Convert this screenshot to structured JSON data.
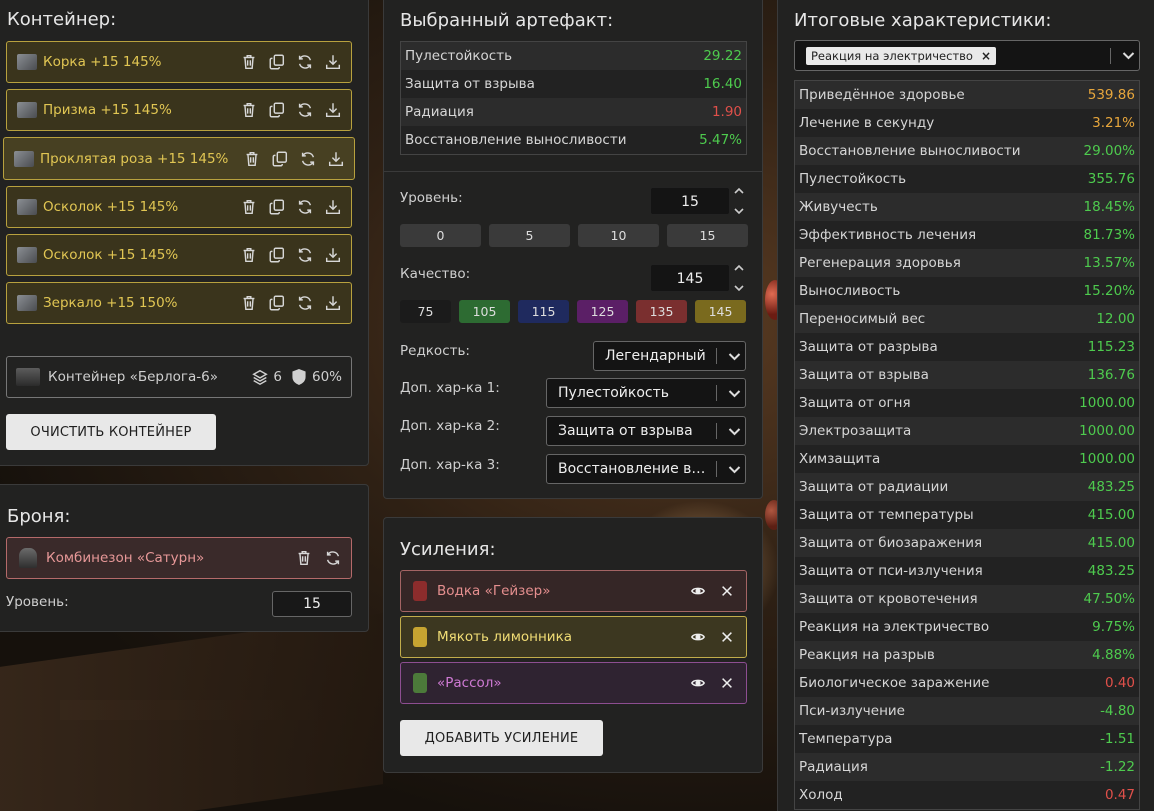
{
  "container": {
    "title": "Контейнер:",
    "artifacts": [
      {
        "name": "Корка +15 145%"
      },
      {
        "name": "Призма +15 145%"
      },
      {
        "name": "Проклятая роза +15 145%"
      },
      {
        "name": "Осколок +15 145%"
      },
      {
        "name": "Осколок +15 145%"
      },
      {
        "name": "Зеркало +15 150%"
      }
    ],
    "box": {
      "name": "Контейнер «Берлога-6»",
      "slots": "6",
      "protection": "60%"
    },
    "clear_label": "ОЧИСТИТЬ КОНТЕЙНЕР"
  },
  "armor": {
    "title": "Броня:",
    "suit": "Комбинезон «Сатурн»",
    "level_label": "Уровень:",
    "level_value": "15"
  },
  "artifact": {
    "title": "Выбранный артефакт:",
    "stats": [
      {
        "name": "Пулестойкость",
        "value": "29.22",
        "tone": "green"
      },
      {
        "name": "Защита от взрыва",
        "value": "16.40",
        "tone": "green"
      },
      {
        "name": "Радиация",
        "value": "1.90",
        "tone": "red"
      },
      {
        "name": "Восстановление выносливости",
        "value": "5.47%",
        "tone": "green"
      }
    ],
    "level_label": "Уровень:",
    "level_value": "15",
    "level_presets": [
      "0",
      "5",
      "10",
      "15"
    ],
    "quality_label": "Качество:",
    "quality_value": "145",
    "quality_presets": [
      {
        "label": "75",
        "color": "#1b1b1b"
      },
      {
        "label": "105",
        "color": "#2d6b32"
      },
      {
        "label": "115",
        "color": "#1f2a5e"
      },
      {
        "label": "125",
        "color": "#5b1f66"
      },
      {
        "label": "135",
        "color": "#7a2f2f"
      },
      {
        "label": "145",
        "color": "#7a6a1e"
      }
    ],
    "rarity_label": "Редкость:",
    "rarity_value": "Легендарный",
    "extra1_label": "Доп. хар-ка 1:",
    "extra1_value": "Пулестойкость",
    "extra2_label": "Доп. хар-ка 2:",
    "extra2_value": "Защита от взрыва",
    "extra3_label": "Доп. хар-ка 3:",
    "extra3_value": "Восстановление выносливости"
  },
  "boosts": {
    "title": "Усиления:",
    "items": [
      {
        "name": "Водка «Гейзер»",
        "text_color": "#e58f8f",
        "border": "#a46464",
        "bg": "#352626",
        "thumb": "#8c2c2c"
      },
      {
        "name": "Мякоть лимонника",
        "text_color": "#f0dc75",
        "border": "#c2ad4b",
        "bg": "#3c3720",
        "thumb": "#c6a431"
      },
      {
        "name": "«Рассол»",
        "text_color": "#cf7ad4",
        "border": "#8d4e91",
        "bg": "#2f2331",
        "thumb": "#4c7a3a"
      }
    ],
    "add_label": "ДОБАВИТЬ УСИЛЕНИЕ"
  },
  "totals": {
    "title": "Итоговые характеристики:",
    "filter_tag": "Реакция на электричество",
    "rows": [
      {
        "name": "Приведённое здоровье",
        "value": "539.86",
        "tone": "orange"
      },
      {
        "name": "Лечение в секунду",
        "value": "3.21%",
        "tone": "orange"
      },
      {
        "name": "Восстановление выносливости",
        "value": "29.00%",
        "tone": "green"
      },
      {
        "name": "Пулестойкость",
        "value": "355.76",
        "tone": "green"
      },
      {
        "name": "Живучесть",
        "value": "18.45%",
        "tone": "green"
      },
      {
        "name": "Эффективность лечения",
        "value": "81.73%",
        "tone": "green"
      },
      {
        "name": "Регенерация здоровья",
        "value": "13.57%",
        "tone": "green"
      },
      {
        "name": "Выносливость",
        "value": "15.20%",
        "tone": "green"
      },
      {
        "name": "Переносимый вес",
        "value": "12.00",
        "tone": "green"
      },
      {
        "name": "Защита от разрыва",
        "value": "115.23",
        "tone": "green"
      },
      {
        "name": "Защита от взрыва",
        "value": "136.76",
        "tone": "green"
      },
      {
        "name": "Защита от огня",
        "value": "1000.00",
        "tone": "green"
      },
      {
        "name": "Электрозащита",
        "value": "1000.00",
        "tone": "green"
      },
      {
        "name": "Химзащита",
        "value": "1000.00",
        "tone": "green"
      },
      {
        "name": "Защита от радиации",
        "value": "483.25",
        "tone": "green"
      },
      {
        "name": "Защита от температуры",
        "value": "415.00",
        "tone": "green"
      },
      {
        "name": "Защита от биозаражения",
        "value": "415.00",
        "tone": "green"
      },
      {
        "name": "Защита от пси-излучения",
        "value": "483.25",
        "tone": "green"
      },
      {
        "name": "Защита от кровотечения",
        "value": "47.50%",
        "tone": "green"
      },
      {
        "name": "Реакция на электричество",
        "value": "9.75%",
        "tone": "green"
      },
      {
        "name": "Реакция на разрыв",
        "value": "4.88%",
        "tone": "green"
      },
      {
        "name": "Биологическое заражение",
        "value": "0.40",
        "tone": "red"
      },
      {
        "name": "Пси-излучение",
        "value": "-4.80",
        "tone": "green"
      },
      {
        "name": "Температура",
        "value": "-1.51",
        "tone": "green"
      },
      {
        "name": "Радиация",
        "value": "-1.22",
        "tone": "green"
      },
      {
        "name": "Холод",
        "value": "0.47",
        "tone": "red"
      }
    ]
  }
}
